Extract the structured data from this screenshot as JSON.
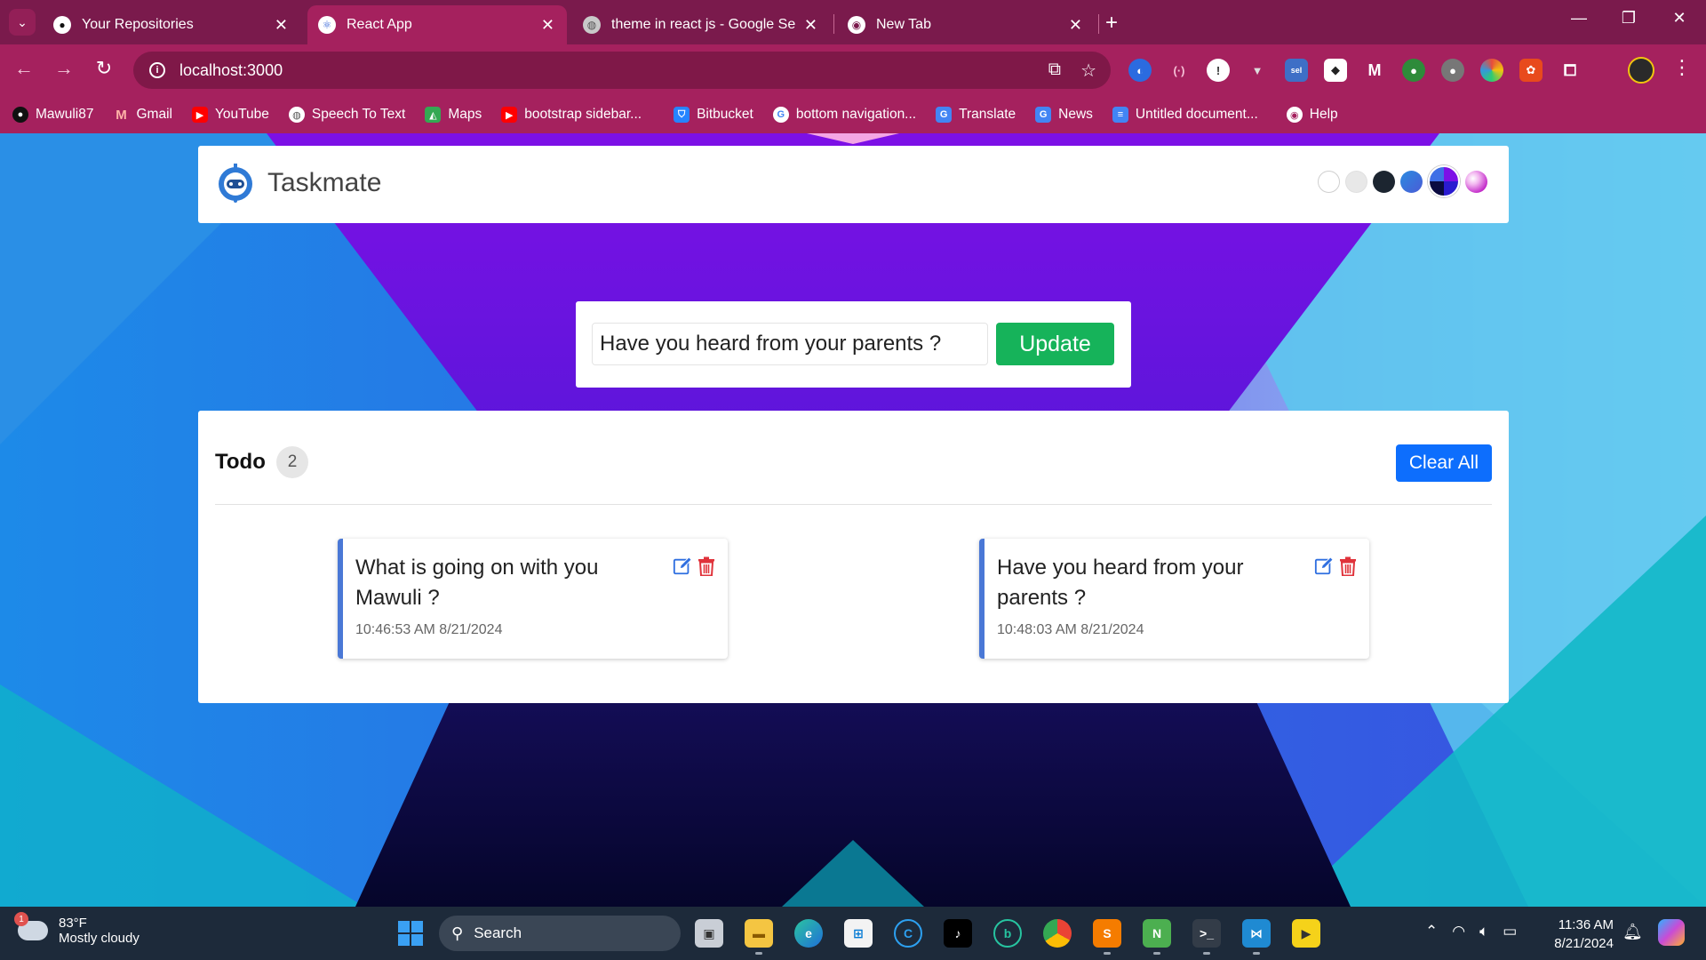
{
  "browser": {
    "tabs": [
      {
        "title": "Your Repositories",
        "icon": "github-icon",
        "active": false
      },
      {
        "title": "React App",
        "icon": "react-icon",
        "active": true
      },
      {
        "title": "theme in react js - Google Search",
        "icon": "globe-icon",
        "active": false
      },
      {
        "title": "New Tab",
        "icon": "chrome-icon",
        "active": false
      }
    ],
    "url": "localhost:3000",
    "bookmarks": [
      {
        "label": "Mawuli87",
        "icon": "github-icon",
        "color": "#111111"
      },
      {
        "label": "Gmail",
        "icon": "gmail-icon",
        "color": "#ea4335"
      },
      {
        "label": "YouTube",
        "icon": "youtube-icon",
        "color": "#ff0000"
      },
      {
        "label": "Speech To Text",
        "icon": "globe-icon",
        "color": "#555555"
      },
      {
        "label": "Maps",
        "icon": "maps-icon",
        "color": "#34a853"
      },
      {
        "label": "bootstrap sidebar...",
        "icon": "youtube-icon",
        "color": "#ff0000"
      },
      {
        "label": "Bitbucket",
        "icon": "bitbucket-icon",
        "color": "#2684ff"
      },
      {
        "label": "bottom navigation...",
        "icon": "google-icon",
        "color": "#4285f4"
      },
      {
        "label": "Translate",
        "icon": "translate-icon",
        "color": "#4285f4"
      },
      {
        "label": "News",
        "icon": "news-icon",
        "color": "#4285f4"
      },
      {
        "label": "Untitled document...",
        "icon": "docs-icon",
        "color": "#4285f4"
      },
      {
        "label": "Help",
        "icon": "chrome-icon",
        "color": "#777777"
      }
    ]
  },
  "app": {
    "brand": "Taskmate",
    "themes": [
      {
        "name": "light",
        "color": "#ffffff"
      },
      {
        "name": "medium",
        "color": "#e8e8e8"
      },
      {
        "name": "dark",
        "color": "#1c2530"
      },
      {
        "name": "blue-gradient",
        "color": "#3b6fd8"
      },
      {
        "name": "gradient-one",
        "color": "#3a1fd6"
      },
      {
        "name": "gradient-two",
        "color": "#d93fd6"
      }
    ],
    "form": {
      "input_value": "Have you heard from your parents ?",
      "submit_label": "Update"
    },
    "todo": {
      "title": "Todo",
      "count": "2",
      "clear_label": "Clear All",
      "tasks": [
        {
          "text": "What is going on with you Mawuli ?",
          "time": "10:46:53 AM 8/21/2024"
        },
        {
          "text": "Have you heard from your parents ?",
          "time": "10:48:03 AM 8/21/2024"
        }
      ]
    },
    "colors": {
      "accent": "#0d6efd",
      "success": "#16b35a",
      "task_border": "#4a78d6",
      "delete": "#e0333b"
    }
  },
  "taskbar": {
    "weather_temp": "83°F",
    "weather_desc": "Mostly cloudy",
    "weather_badge": "1",
    "search_label": "Search",
    "time": "11:36 AM",
    "date": "8/21/2024"
  }
}
